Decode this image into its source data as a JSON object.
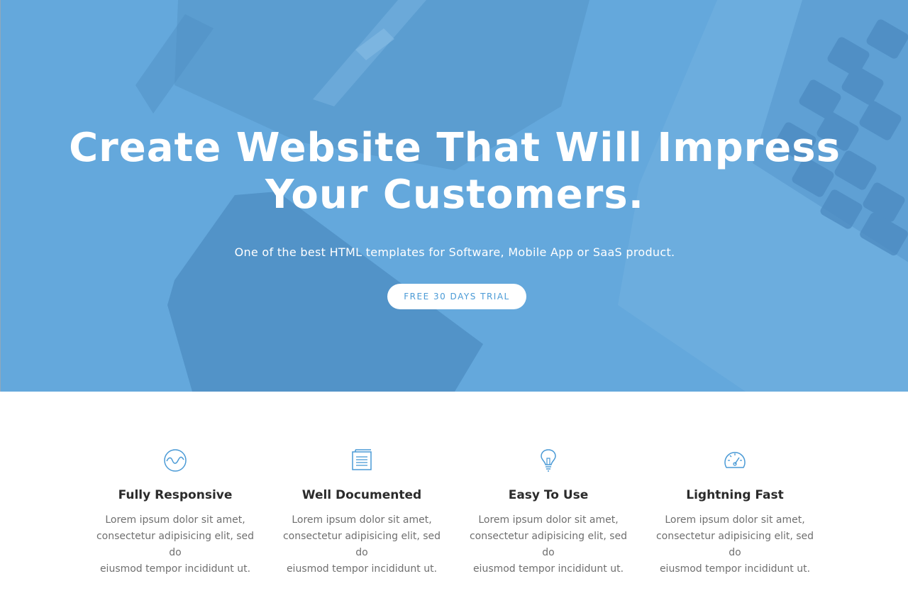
{
  "hero": {
    "title_line1": "Create Website That Will Impress",
    "title_line2": "Your Customers.",
    "subtitle": "One of the best HTML templates for Software, Mobile App or SaaS product.",
    "cta_label": "FREE 30 DAYS TRIAL",
    "background_color": "#64a8dc"
  },
  "features": [
    {
      "icon": "wave-circle-icon",
      "title": "Fully Responsive",
      "line1": "Lorem ipsum dolor sit amet,",
      "line2": "consectetur adipisicing elit, sed do",
      "line3": "eiusmod tempor incididunt ut."
    },
    {
      "icon": "document-icon",
      "title": "Well Documented",
      "line1": "Lorem ipsum dolor sit amet,",
      "line2": "consectetur adipisicing elit, sed do",
      "line3": "eiusmod tempor incididunt ut."
    },
    {
      "icon": "lightbulb-icon",
      "title": "Easy To Use",
      "line1": "Lorem ipsum dolor sit amet,",
      "line2": "consectetur adipisicing elit, sed do",
      "line3": "eiusmod tempor incididunt ut."
    },
    {
      "icon": "speedometer-icon",
      "title": "Lightning Fast",
      "line1": "Lorem ipsum dolor sit amet,",
      "line2": "consectetur adipisicing elit, sed do",
      "line3": "eiusmod tempor incididunt ut."
    }
  ],
  "colors": {
    "accent": "#4a9ad6",
    "heading": "#2b2b2b",
    "body_text": "#6f6f6f"
  }
}
